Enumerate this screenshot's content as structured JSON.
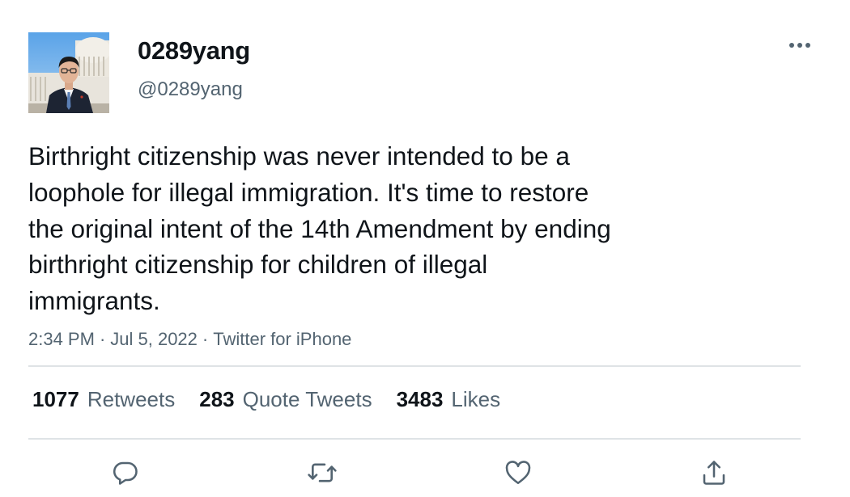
{
  "tweet": {
    "author": {
      "display_name": "0289yang",
      "handle": "@0289yang",
      "avatar_icon": "profile-photo"
    },
    "text_lines": [
      "Birthright citizenship was never intended to be a",
      "loophole for illegal immigration. It's time to restore",
      "the original intent of the 14th Amendment by ending",
      "birthright citizenship for children of illegal",
      "immigrants."
    ],
    "time": "2:34 PM",
    "date": "Jul 5, 2022",
    "source": "Twitter for iPhone",
    "separator": "·",
    "stats": {
      "retweets": {
        "count": "1077",
        "label": "Retweets"
      },
      "quote_tweets": {
        "count": "283",
        "label": "Quote Tweets"
      },
      "likes": {
        "count": "3483",
        "label": "Likes"
      }
    },
    "actions": [
      "reply-icon",
      "retweet-icon",
      "like-icon",
      "share-icon"
    ],
    "more_icon": "more-icon"
  },
  "colors": {
    "text_primary": "#0f1419",
    "text_secondary": "#536471",
    "divider": "#dfe3e6"
  }
}
